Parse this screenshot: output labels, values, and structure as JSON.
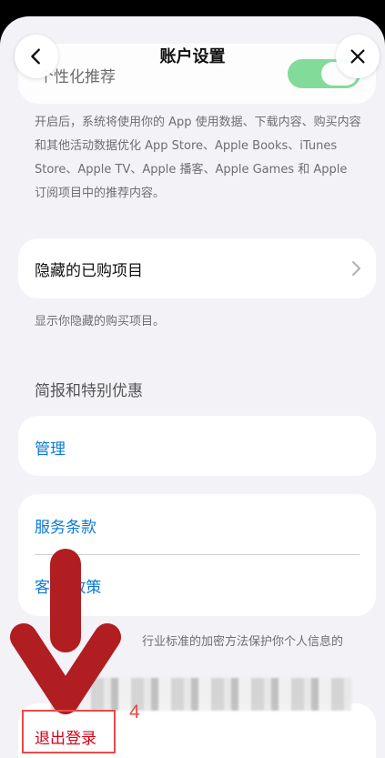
{
  "header": {
    "title": "账户设置",
    "back_icon": "chevron-left-icon",
    "close_icon": "close-icon"
  },
  "personalized": {
    "label": "个性化推荐",
    "toggle_on": true,
    "description": "开启后，系统将使用你的 App 使用数据、下载内容、购买内容和其他活动数据优化 App Store、Apple Books、iTunes Store、Apple TV、Apple 播客、Apple Games 和 Apple 订阅项目中的推荐内容。"
  },
  "hidden_purchases": {
    "label": "隐藏的已购项目",
    "description": "显示你隐藏的购买项目。"
  },
  "newsletters": {
    "section_title": "简报和特别优惠",
    "manage_label": "管理"
  },
  "legal": {
    "terms_label": "服务条款",
    "privacy_label": "客户隐私政策",
    "privacy_visible": "客 私政策",
    "footer_note": "行业标准的加密方法保护你个人信息的"
  },
  "account": {
    "sign_out_label": "退出登录"
  },
  "annotation": {
    "step_number": "4",
    "color": "#e84a4a",
    "arrow_color": "#b01e22"
  },
  "colors": {
    "link": "#0a7ad7",
    "toggle_on": "#34c759",
    "background": "#f2f2f7"
  }
}
